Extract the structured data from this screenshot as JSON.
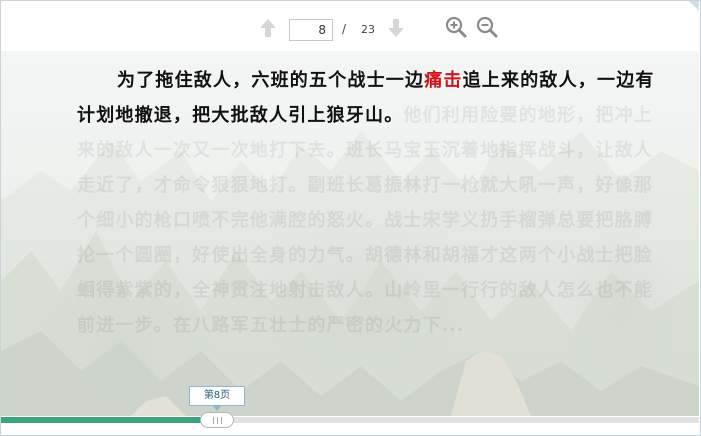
{
  "toolbar": {
    "current_page": "8",
    "separator": "/",
    "total_pages": "23",
    "icons": [
      "arrow-up-icon",
      "arrow-down-icon",
      "zoom-in-icon",
      "zoom-out-icon"
    ]
  },
  "content": {
    "visible_text_1": "为了拖住敌人，六班的五个战士一边",
    "highlight": "痛击",
    "visible_text_2": "追上来的敌人，一边有计划地撤退，把大批敌人引上狼牙山。",
    "faded_text": "他们利用险要的地形，把冲上来的敌人一次又一次地打下去。班长马宝玉沉着地指挥战斗，让敌人走近了，才命令狠狠地打。副班长葛振林打一枪就大吼一声，好像那个细小的枪口喷不完他满腔的怒火。战士宋学义扔手榴弹总要把胳膊抡一个圆圈，好使出全身的力气。胡德林和胡福才这两个小战士把脸蛔得紫紫的，全神贯注地射击敌人。山岭里一行行的敌人怎么也不能前进一步。在八路军五壮士的严密的火力下...",
    "highlight_color": "#d0131b"
  },
  "progress": {
    "value": 0.31,
    "tooltip": "第8页",
    "fill_color": "#3aa57a"
  }
}
